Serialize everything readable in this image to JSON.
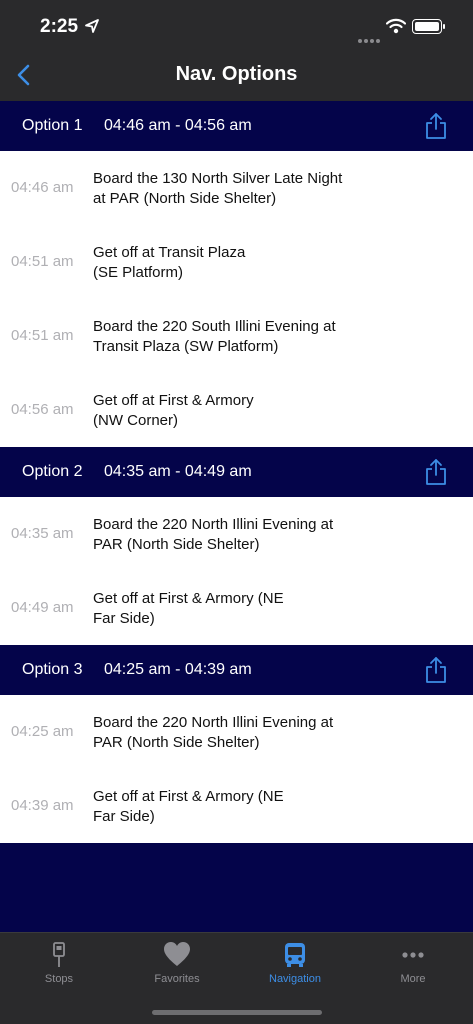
{
  "status": {
    "time": "2:25"
  },
  "nav": {
    "title": "Nav. Options"
  },
  "options": [
    {
      "label": "Option 1",
      "range": "04:46 am - 04:56 am",
      "steps": [
        {
          "time": "04:46 am",
          "text": "Board the 130 North Silver Late Night at PAR (North Side Shelter)"
        },
        {
          "time": "04:51 am",
          "text": "Get off at Transit Plaza (SE Platform)"
        },
        {
          "time": "04:51 am",
          "text": "Board the 220 South Illini Evening at Transit Plaza (SW Platform)"
        },
        {
          "time": "04:56 am",
          "text": "Get off at First & Armory (NW Corner)"
        }
      ]
    },
    {
      "label": "Option 2",
      "range": "04:35 am - 04:49 am",
      "steps": [
        {
          "time": "04:35 am",
          "text": "Board the 220 North Illini Evening at PAR (North Side Shelter)"
        },
        {
          "time": "04:49 am",
          "text": "Get off at First & Armory (NE Far Side)"
        }
      ]
    },
    {
      "label": "Option 3",
      "range": "04:25 am - 04:39 am",
      "steps": [
        {
          "time": "04:25 am",
          "text": "Board the 220 North Illini Evening at PAR (North Side Shelter)"
        },
        {
          "time": "04:39 am",
          "text": "Get off at First & Armory (NE Far Side)"
        }
      ]
    }
  ],
  "tabs": [
    {
      "label": "Stops",
      "icon": "bus-stop-icon"
    },
    {
      "label": "Favorites",
      "icon": "heart-icon"
    },
    {
      "label": "Navigation",
      "icon": "bus-icon",
      "active": true
    },
    {
      "label": "More",
      "icon": "ellipsis-icon"
    }
  ],
  "colors": {
    "accent": "#3d8ee6",
    "header_bg": "#04044a",
    "bar_bg": "#2a2a2c"
  }
}
